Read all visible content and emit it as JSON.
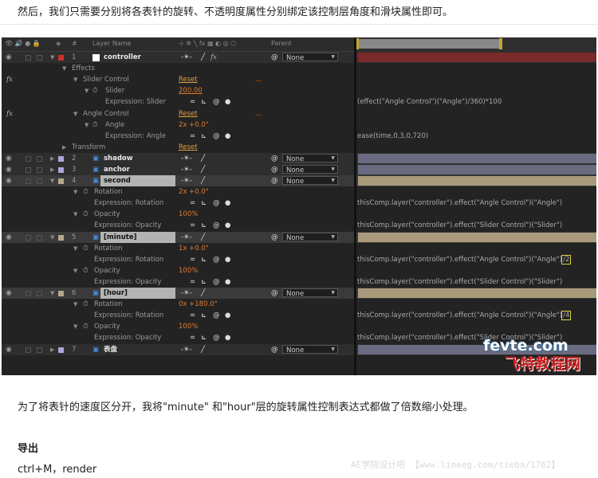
{
  "article": {
    "intro": "然后，我们只需要分别将各表针的旋转、不透明度属性分别绑定该控制层角度和滑块属性即可。",
    "after": "为了将表针的速度区分开，我将\"minute\" 和\"hour\"层的旋转属性控制表达式都做了倍数缩小处理。",
    "export_heading": "导出",
    "export_text": "ctrl+M，render"
  },
  "header": {
    "num": "#",
    "layer_name": "Layer Name",
    "parent": "Parent"
  },
  "rows": {
    "r1": {
      "num": "1",
      "name": "controller",
      "parent": "None"
    },
    "effects": "Effects",
    "slider_control": "Slider Control",
    "slider_control_reset": "Reset",
    "slider_control_dots": "...",
    "slider": "Slider",
    "slider_value": "200.00",
    "expr_slider": "Expression: Slider",
    "expr_slider_code": "(effect(\"Angle Control\")(\"Angle\")/360)*100",
    "angle_control": "Angle Control",
    "angle_control_reset": "Reset",
    "angle_control_dots": "...",
    "angle": "Angle",
    "angle_value": "2x +0.0°",
    "expr_angle": "Expression: Angle",
    "expr_angle_code": "ease(time,0,3,0,720)",
    "transform": "Transform",
    "transform_reset": "Reset",
    "r2": {
      "num": "2",
      "name": "shadow",
      "parent": "None"
    },
    "r3": {
      "num": "3",
      "name": "anchor",
      "parent": "None"
    },
    "r4": {
      "num": "4",
      "name": "second",
      "parent": "None"
    },
    "r4_rotation": "Rotation",
    "r4_rotation_value": "2x +0.0°",
    "r4_expr_rotation": "Expression: Rotation",
    "r4_expr_rotation_code": "thisComp.layer(\"controller\").effect(\"Angle Control\")(\"Angle\")",
    "r4_opacity": "Opacity",
    "r4_opacity_value": "100%",
    "r4_expr_opacity": "Expression: Opacity",
    "r4_expr_opacity_code": "thisComp.layer(\"controller\").effect(\"Slider Control\")(\"Slider\")",
    "r5": {
      "num": "5",
      "name": "[minute]",
      "parent": "None"
    },
    "r5_rotation": "Rotation",
    "r5_rotation_value": "1x +0.0°",
    "r5_expr_rotation": "Expression: Rotation",
    "r5_expr_rotation_code": "thisComp.layer(\"controller\").effect(\"Angle Control\")(\"Angle\")",
    "r5_expr_rotation_suffix": "/2",
    "r5_opacity": "Opacity",
    "r5_opacity_value": "100%",
    "r5_expr_opacity": "Expression: Opacity",
    "r5_expr_opacity_code": "thisComp.layer(\"controller\").effect(\"Slider Control\")(\"Slider\")",
    "r6": {
      "num": "6",
      "name": "[hour]",
      "parent": "None"
    },
    "r6_rotation": "Rotation",
    "r6_rotation_value": "0x +180.0°",
    "r6_expr_rotation": "Expression: Rotation",
    "r6_expr_rotation_code": "thisComp.layer(\"controller\").effect(\"Angle Control\")(\"Angle\")",
    "r6_expr_rotation_suffix": "/4",
    "r6_opacity": "Opacity",
    "r6_opacity_value": "100%",
    "r6_expr_opacity": "Expression: Opacity",
    "r6_expr_opacity_code": "thisComp.layer(\"controller\").effect(\"Slider Control\")(\"Slider\")",
    "r7": {
      "num": "7",
      "name": "表盘",
      "parent": "None"
    }
  },
  "watermark": {
    "site": "fevte.com",
    "site_cn": "飞特教程网",
    "bottom": "AE学院设计吧 【www.lineeg.com/tieba/1762】"
  },
  "colors": {
    "controller_label": "#c83232",
    "layer_label": "#a8a8d8",
    "tan_label": "#b8a888",
    "controller_bar": "#7a2a2a",
    "layer_bar": "#6a6a80",
    "tan_bar": "#a89a7a",
    "value_orange": "#e07a2f"
  }
}
